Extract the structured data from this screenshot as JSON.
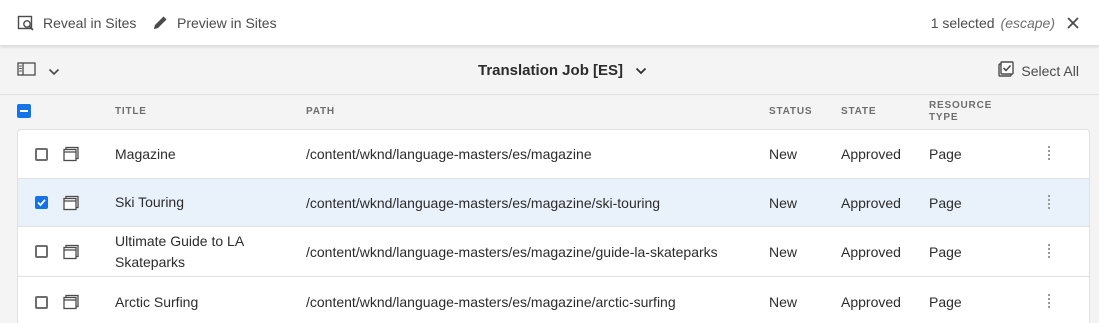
{
  "actionbar": {
    "reveal_label": "Reveal in Sites",
    "preview_label": "Preview in Sites",
    "selection_count": "1 selected",
    "escape_hint": "(escape)"
  },
  "toolbar": {
    "title": "Translation Job [ES]",
    "select_all_label": "Select All"
  },
  "table": {
    "headers": {
      "title": "TITLE",
      "path": "PATH",
      "status": "STATUS",
      "state": "STATE",
      "resource_type_line1": "RESOURCE",
      "resource_type_line2": "TYPE"
    },
    "rows": [
      {
        "title": "Magazine",
        "path": "/content/wknd/language-masters/es/magazine",
        "status": "New",
        "state": "Approved",
        "type": "Page",
        "selected": false
      },
      {
        "title": "Ski Touring",
        "path": "/content/wknd/language-masters/es/magazine/ski-touring",
        "status": "New",
        "state": "Approved",
        "type": "Page",
        "selected": true
      },
      {
        "title": "Ultimate Guide to LA Skateparks",
        "path": "/content/wknd/language-masters/es/magazine/guide-la-skateparks",
        "status": "New",
        "state": "Approved",
        "type": "Page",
        "selected": false
      },
      {
        "title": "Arctic Surfing",
        "path": "/content/wknd/language-masters/es/magazine/arctic-surfing",
        "status": "New",
        "state": "Approved",
        "type": "Page",
        "selected": false
      }
    ]
  },
  "colors": {
    "accent": "#1473e6",
    "selected_row": "#e9f1fb"
  },
  "icons": {
    "reveal": "reveal-search-icon",
    "preview": "pencil-icon",
    "close": "close-icon",
    "rail": "rail-toggle-icon",
    "chevron": "chevron-down-icon",
    "select_all": "select-all-icon",
    "page": "page-icon",
    "drag": "drag-handle-icon"
  }
}
